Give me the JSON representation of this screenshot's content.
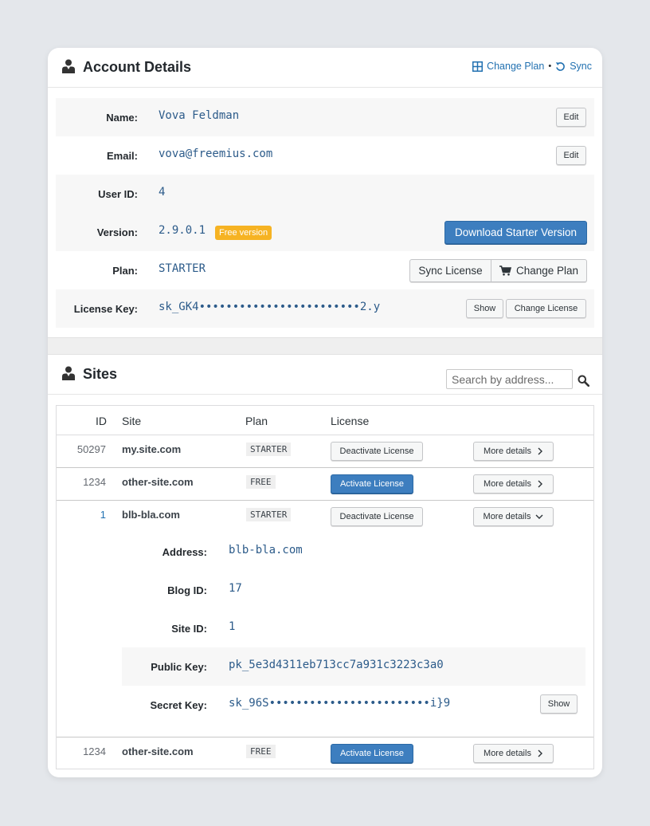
{
  "account": {
    "title": "Account Details",
    "links": {
      "change_plan": "Change Plan",
      "separator": "•",
      "sync": "Sync"
    },
    "rows": {
      "name": {
        "label": "Name:",
        "value": "Vova Feldman",
        "edit": "Edit"
      },
      "email": {
        "label": "Email:",
        "value": "vova@freemius.com",
        "edit": "Edit"
      },
      "user_id": {
        "label": "User ID:",
        "value": "4"
      },
      "version": {
        "label": "Version:",
        "value": "2.9.0.1",
        "badge": "Free version",
        "download": "Download Starter Version"
      },
      "plan": {
        "label": "Plan:",
        "value": "STARTER",
        "sync_license": "Sync License",
        "change_plan": "Change Plan"
      },
      "license_key": {
        "label": "License Key:",
        "value": "sk_GK4••••••••••••••••••••••••2.y",
        "show": "Show",
        "change_license": "Change License"
      }
    }
  },
  "sites": {
    "title": "Sites",
    "search_placeholder": "Search by address...",
    "columns": {
      "id": "ID",
      "site": "Site",
      "plan": "Plan",
      "license": "License"
    },
    "rows": [
      {
        "id": "50297",
        "site": "my.site.com",
        "plan": "STARTER",
        "license_action": "Deactivate License",
        "more": "More details"
      },
      {
        "id": "1234",
        "site": "other-site.com",
        "plan": "FREE",
        "license_action": "Activate License",
        "more": "More details"
      },
      {
        "id": "1",
        "site": "blb-bla.com",
        "plan": "STARTER",
        "license_action": "Deactivate License",
        "more": "More details"
      },
      {
        "id": "1234",
        "site": "other-site.com",
        "plan": "FREE",
        "license_action": "Activate License",
        "more": "More details"
      }
    ],
    "expanded": {
      "address": {
        "label": "Address:",
        "value": "blb-bla.com"
      },
      "blog_id": {
        "label": "Blog ID:",
        "value": "17"
      },
      "site_id": {
        "label": "Site ID:",
        "value": "1"
      },
      "public_key": {
        "label": "Public Key:",
        "value": "pk_5e3d4311eb713cc7a931c3223c3a0"
      },
      "secret_key": {
        "label": "Secret Key:",
        "value": "sk_96S••••••••••••••••••••••••i}9",
        "show": "Show"
      }
    }
  },
  "colors": {
    "accent": "#3d7ebf",
    "link": "#2271b1",
    "value": "#2c5b8a",
    "badge": "#f6b323"
  }
}
